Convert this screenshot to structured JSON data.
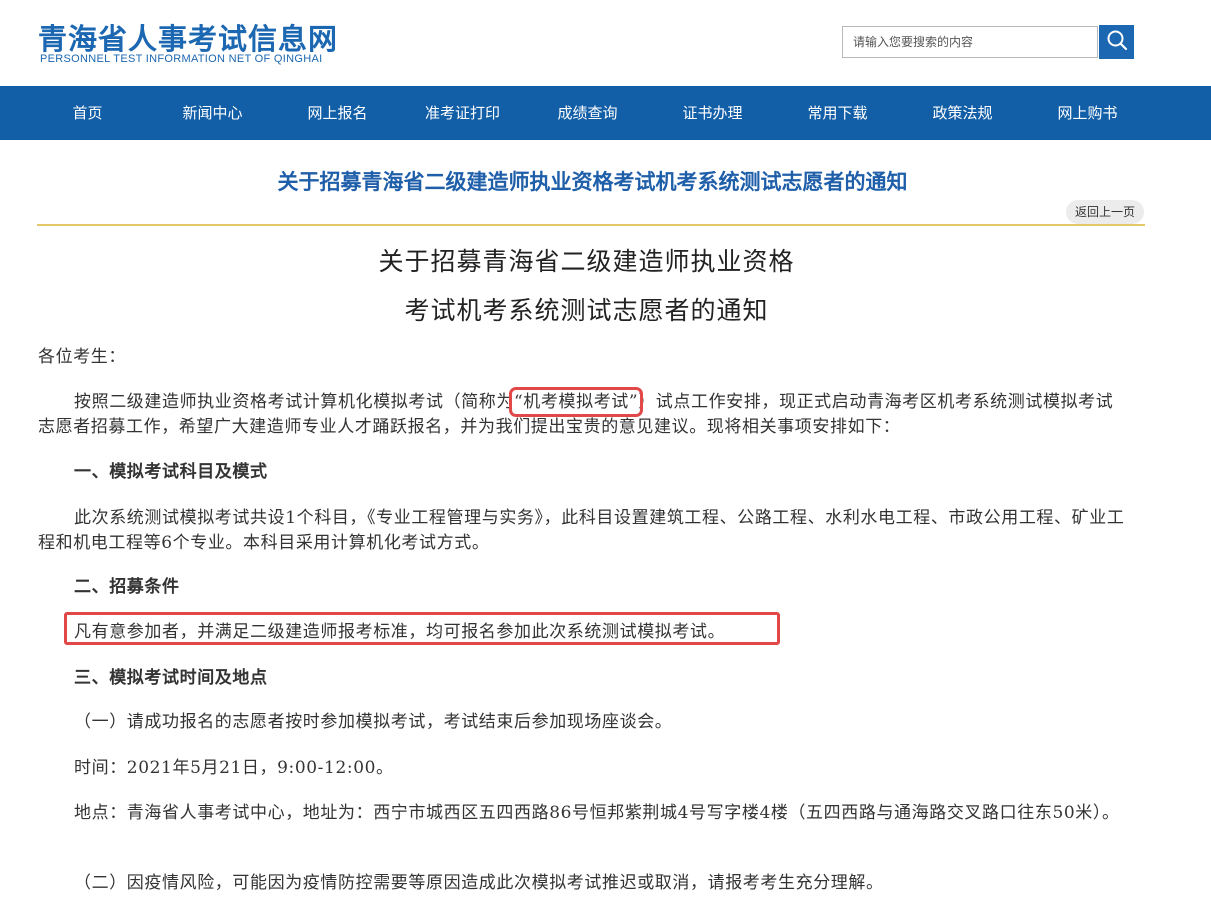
{
  "header": {
    "logo_cn": "青海省人事考试信息网",
    "logo_en": "PERSONNEL TEST INFORMATION NET OF QINGHAI",
    "search_placeholder": "请输入您要搜索的内容",
    "search_icon": "search-icon"
  },
  "nav": {
    "items": [
      "首页",
      "新闻中心",
      "网上报名",
      "准考证打印",
      "成绩查询",
      "证书办理",
      "常用下载",
      "政策法规",
      "网上购书"
    ]
  },
  "article": {
    "title": "关于招募青海省二级建造师执业资格考试机考系统测试志愿者的通知",
    "back_label": "返回上一页"
  },
  "document": {
    "title_line1": "关于招募青海省二级建造师执业资格",
    "title_line2": "考试机考系统测试志愿者的通知",
    "greeting": "各位考生：",
    "intro_before": "按照二级建造师执业资格考试计算机化模拟考试（简称为",
    "intro_highlight": "“机考模拟考试”",
    "intro_after": "）试点工作安排，现正式启动青海考区机考系统测试模拟考试志愿者招募工作，希望广大建造师专业人才踊跃报名，并为我们提出宝贵的意见建议。现将相关事项安排如下：",
    "section1_heading": "一、模拟考试科目及模式",
    "section1_body": "此次系统测试模拟考试共设1个科目，《专业工程管理与实务》，此科目设置建筑工程、公路工程、水利水电工程、市政公用工程、矿业工程和机电工程等6个专业。本科目采用计算机化考试方式。",
    "section2_heading": "二、招募条件",
    "section2_body": "凡有意参加者，并满足二级建造师报考标准，均可报名参加此次系统测试模拟考试。",
    "section3_heading": "三、模拟考试时间及地点",
    "section3_item1": "（一）请成功报名的志愿者按时参加模拟考试，考试结束后参加现场座谈会。",
    "time_line": "时间：2021年5月21日，9:00-12:00。",
    "place_line": "地点：青海省人事考试中心，地址为：西宁市城西区五四西路86号恒邦紫荆城4号写字楼4楼（五四西路与通海路交叉路口往东50米）。",
    "section3_item2": "（二）因疫情风险，可能因为疫情防控需要等原因造成此次模拟考试推迟或取消，请报考考生充分理解。"
  }
}
